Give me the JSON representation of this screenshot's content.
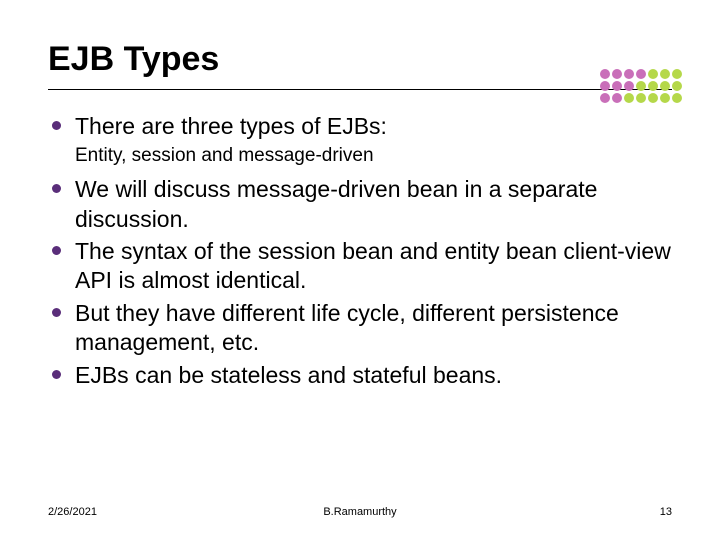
{
  "title": "EJB Types",
  "bullets": [
    {
      "text": "There are three types of EJBs:",
      "sub": "Entity, session and message-driven"
    },
    {
      "text": "We will discuss message-driven bean in a separate discussion."
    },
    {
      "text": "The syntax of the session bean and entity bean client-view API is almost identical."
    },
    {
      "text": "But they have different life cycle, different persistence management, etc."
    },
    {
      "text": "EJBs can be stateless and stateful beans."
    }
  ],
  "footer": {
    "date": "2/26/2021",
    "author": "B.Ramamurthy",
    "page": "13"
  },
  "dot_colors": [
    "#c96fb9",
    "#c96fb9",
    "#c96fb9",
    "#c96fb9",
    "#b5d84a",
    "#b5d84a",
    "#b5d84a",
    "#c96fb9",
    "#c96fb9",
    "#c96fb9",
    "#b5d84a",
    "#b5d84a",
    "#b5d84a",
    "#b5d84a",
    "#c96fb9",
    "#c96fb9",
    "#b5d84a",
    "#b5d84a",
    "#b5d84a",
    "#b5d84a",
    "#b5d84a"
  ]
}
